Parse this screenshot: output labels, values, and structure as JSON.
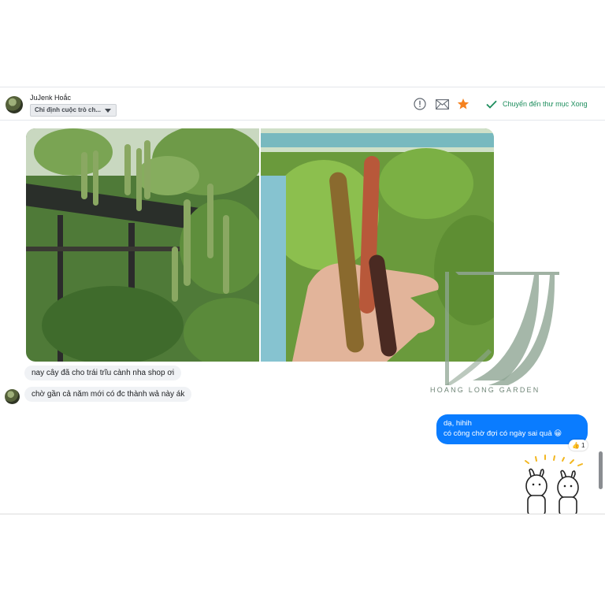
{
  "header": {
    "contact_name": "JuJenk Hoắc",
    "assign_label": "Chỉ định cuộc trò ch...",
    "move_done_label": "Chuyển đến thư mục Xong",
    "icons": [
      "alert-circle-icon",
      "envelope-icon",
      "star-icon",
      "checkmark-icon"
    ]
  },
  "messages": {
    "incoming": [
      "nay cây đã cho trái trĩu cành nha shop ơi",
      "chờ gần cả năm mới có đc thành wả này ák"
    ],
    "outgoing": {
      "line1": "dạ, hihih",
      "line2": "có công chờ đợi có ngày sai quả 😀",
      "reaction_emoji": "👍",
      "reaction_count": "1"
    }
  },
  "watermark": {
    "text": "HOANG LONG GARDEN"
  },
  "colors": {
    "outgoing_bubble": "#0a7cff",
    "incoming_bubble": "#f0f2f5",
    "accent_green": "#1c8d5c",
    "star": "#f5821f",
    "watermark": "#6f8577"
  }
}
